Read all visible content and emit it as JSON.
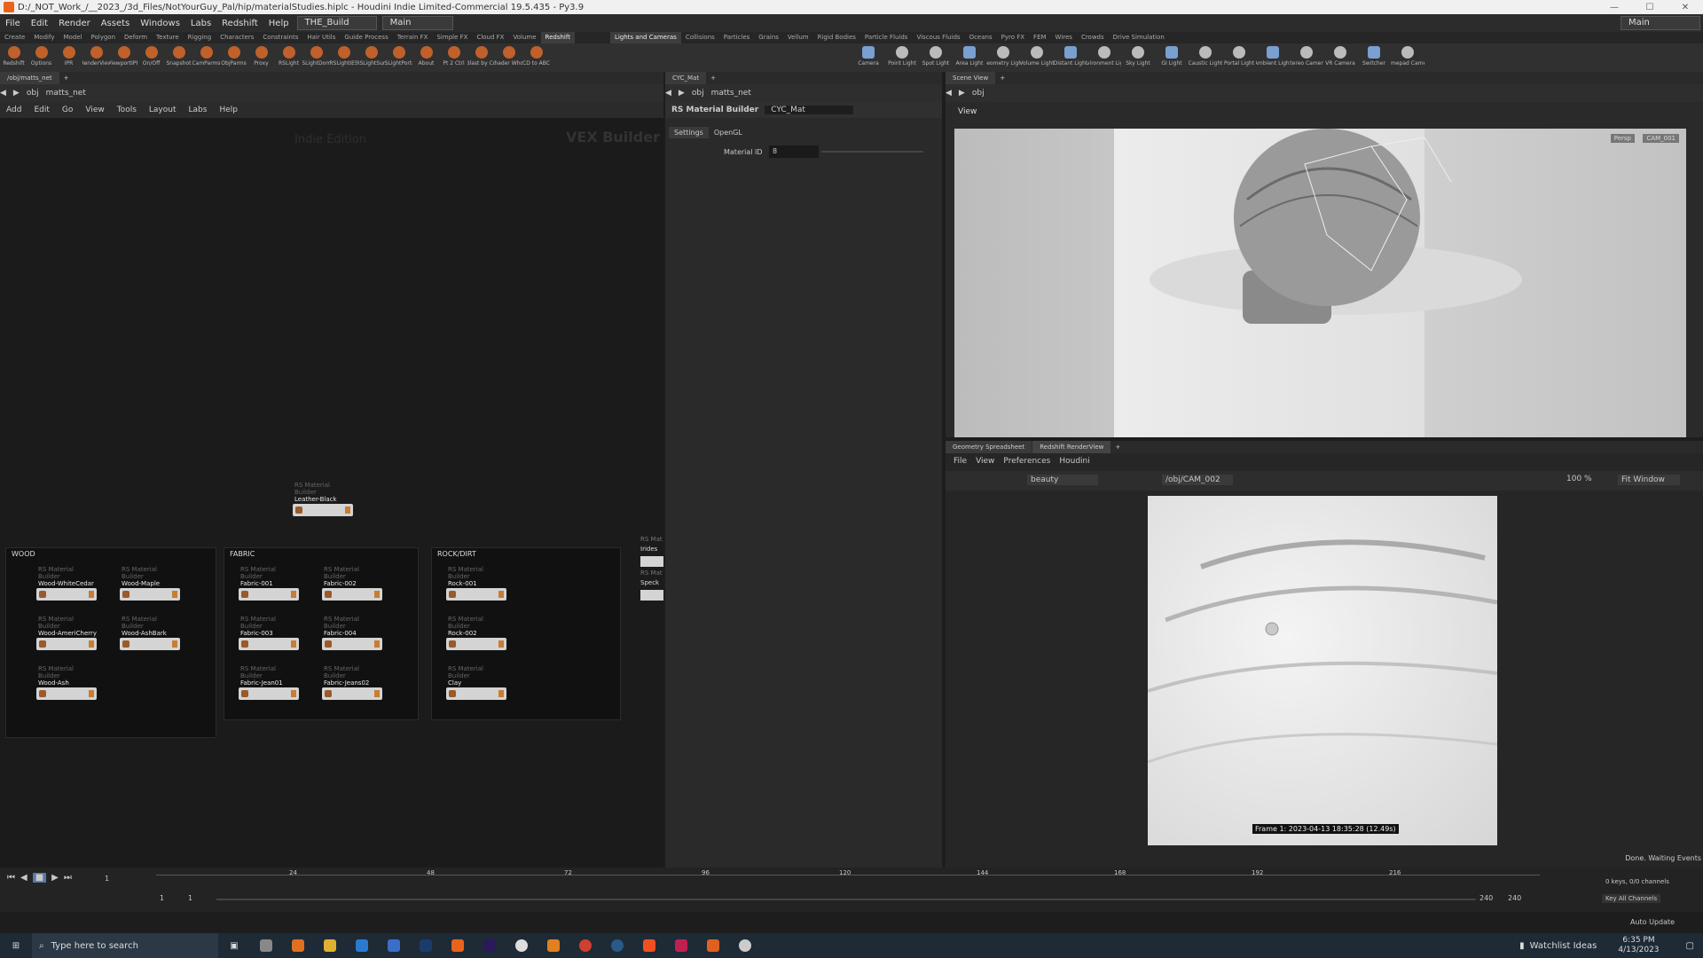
{
  "window": {
    "title": "D:/_NOT_Work_/__2023_/3d_Files/NotYourGuy_Pal/hip/materialStudies.hiplc - Houdini Indie Limited-Commercial 19.5.435 - Py3.9"
  },
  "menu": [
    "File",
    "Edit",
    "Render",
    "Assets",
    "Windows",
    "Labs",
    "Redshift",
    "Help"
  ],
  "desktop": "THE_Build",
  "desktop2": "Main",
  "desktop_right": "Main",
  "shelf_tabs_left": [
    "Create",
    "Modify",
    "Model",
    "Polygon",
    "Deform",
    "Texture",
    "Rigging",
    "Characters",
    "Constraints",
    "Hair Utils",
    "Guide Process",
    "Terrain FX",
    "Simple FX",
    "Cloud FX",
    "Volume",
    "Redshift"
  ],
  "shelf_tabs_right": [
    "Lights and Cameras",
    "Collisions",
    "Particles",
    "Grains",
    "Vellum",
    "Rigid Bodies",
    "Particle Fluids",
    "Viscous Fluids",
    "Oceans",
    "Pyro FX",
    "FEM",
    "Wires",
    "Crowds",
    "Drive Simulation"
  ],
  "tools_left": [
    "Redshift",
    "Options",
    "IPR",
    "RenderView",
    "ViewportIPR",
    "On/Off",
    "Snapshot",
    "CamParms",
    "ObjParms",
    "Proxy",
    "RSLight",
    "RSLightDome",
    "RSLightIES",
    "RSLightSun",
    "RSLightPortal",
    "About",
    "Pt 2 Ctrl",
    "Blast by Cd",
    "Shader Who?",
    "CD to ABC"
  ],
  "tools_right": [
    "Camera",
    "Point Light",
    "Spot Light",
    "Area Light",
    "Geometry Light",
    "Volume Light",
    "Distant Light",
    "Environment Light",
    "Sky Light",
    "GI Light",
    "Caustic Light",
    "Portal Light",
    "Ambient Light",
    "Stereo Camera",
    "VR Camera",
    "Switcher",
    "Gamepad Camera"
  ],
  "net": {
    "tab": "/obj/matts_net",
    "path_obj": "obj",
    "path_net": "matts_net",
    "menus": [
      "Add",
      "Edit",
      "Go",
      "View",
      "Tools",
      "Layout",
      "Labs",
      "Help"
    ],
    "watermark": "Indie Edition",
    "context": "VEX Builder",
    "orphan": {
      "type": "RS Material Builder",
      "name": "Leather-Black"
    },
    "boxes": [
      {
        "label": "WOOD",
        "nodes": [
          {
            "t": "RS Material Builder",
            "n": "Wood-WhiteCedar"
          },
          {
            "t": "RS Material Builder",
            "n": "Wood-Maple"
          },
          {
            "t": "RS Material Builder",
            "n": "Wood-AmeriCherry"
          },
          {
            "t": "RS Material Builder",
            "n": "Wood-AshBark"
          },
          {
            "t": "RS Material Builder",
            "n": "Wood-Ash"
          }
        ]
      },
      {
        "label": "FABRIC",
        "nodes": [
          {
            "t": "RS Material Builder",
            "n": "Fabric-001"
          },
          {
            "t": "RS Material Builder",
            "n": "Fabric-002"
          },
          {
            "t": "RS Material Builder",
            "n": "Fabric-003"
          },
          {
            "t": "RS Material Builder",
            "n": "Fabric-004"
          },
          {
            "t": "RS Material Builder",
            "n": "Fabric-Jean01"
          },
          {
            "t": "RS Material Builder",
            "n": "Fabric-Jeans02"
          }
        ]
      },
      {
        "label": "ROCK/DIRT",
        "nodes": [
          {
            "t": "RS Material Builder",
            "n": "Rock-001"
          },
          {
            "t": "RS Material Builder",
            "n": "Rock-002"
          },
          {
            "t": "RS Material Builder",
            "n": "Clay"
          }
        ]
      }
    ],
    "partial": [
      "RS Mat",
      "Irides",
      "RS Mat",
      "Speck"
    ]
  },
  "params": {
    "tab": "CYC_Mat",
    "path_obj": "obj",
    "path_net": "matts_net",
    "node_type": "RS Material Builder",
    "node_name": "CYC_Mat",
    "tabs": [
      "Settings",
      "OpenGL"
    ],
    "material_id_label": "Material ID",
    "material_id_value": "8"
  },
  "scene": {
    "tab": "Scene View",
    "path": "obj",
    "view_label": "View",
    "persp": "Persp",
    "cam": "CAM_001"
  },
  "render": {
    "tabs": [
      "Geometry Spreadsheet",
      "Redshift RenderView"
    ],
    "menus": [
      "File",
      "View",
      "Preferences",
      "Houdini"
    ],
    "aov": "beauty",
    "camera": "/obj/CAM_002",
    "zoom": "100 %",
    "fit": "Fit Window",
    "frame_info": "Frame 1: 2023-04-13 18:35:28 (12.49s)",
    "status": "Done. Waiting Events"
  },
  "timeline": {
    "ticks": [
      "24",
      "48",
      "72",
      "96",
      "120",
      "144",
      "168",
      "192",
      "216"
    ],
    "frame": "1",
    "start": "1",
    "start2": "1",
    "end": "240",
    "end2": "240",
    "keys": "0 keys, 0/0 channels",
    "key_all": "Key All Channels",
    "auto": "Auto Update"
  },
  "taskbar": {
    "search": "Type here to search",
    "watchlist": "Watchlist Ideas",
    "time": "6:35 PM",
    "date": "4/13/2023"
  }
}
